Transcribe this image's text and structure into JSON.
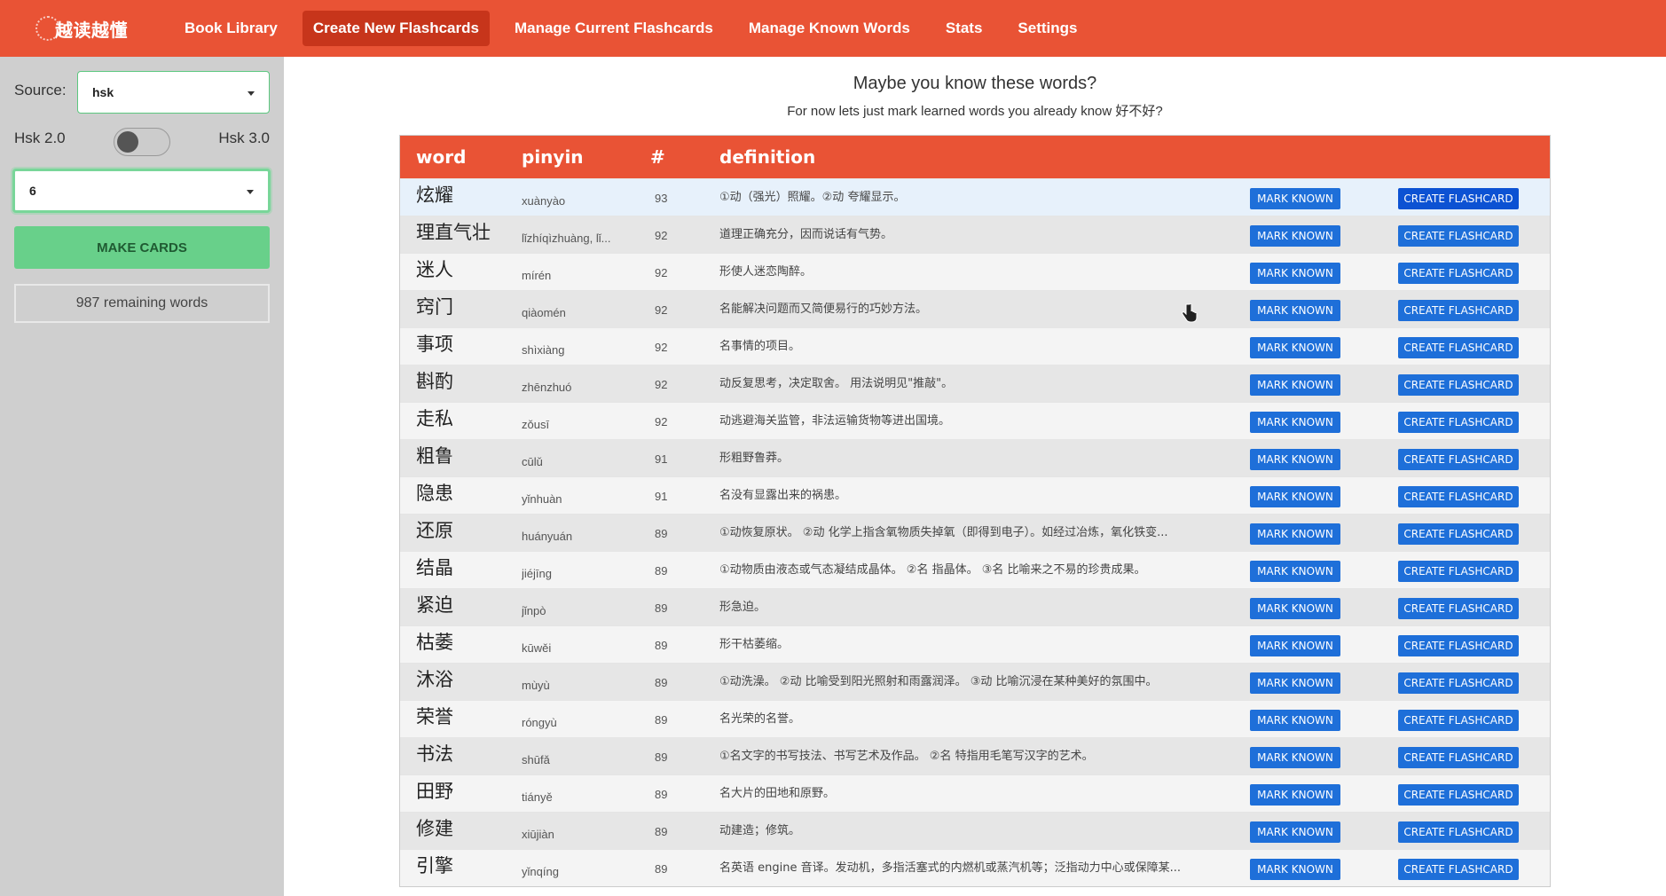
{
  "app": {
    "logo_text": "越读越懂",
    "nav": [
      {
        "label": "Book Library",
        "active": false
      },
      {
        "label": "Create New Flashcards",
        "active": true
      },
      {
        "label": "Manage Current Flashcards",
        "active": false
      },
      {
        "label": "Manage Known Words",
        "active": false
      },
      {
        "label": "Stats",
        "active": false
      },
      {
        "label": "Settings",
        "active": false
      }
    ]
  },
  "sidebar": {
    "source_label": "Source:",
    "source_value": "hsk",
    "hsk_left_label": "Hsk 2.0",
    "hsk_right_label": "Hsk 3.0",
    "level_value": "6",
    "make_cards_label": "MAKE CARDS",
    "remaining_text": "987 remaining words"
  },
  "main": {
    "heading": "Maybe you know these words?",
    "subheading": "For now lets just mark learned words you already know 好不好?",
    "table": {
      "headers": {
        "word": "word",
        "pinyin": "pinyin",
        "count": "#",
        "definition": "definition"
      },
      "mark_known_label": "MARK KNOWN",
      "create_flashcard_label": "CREATE FLASHCARD",
      "rows": [
        {
          "word": "炫耀",
          "pinyin": "xuànyào",
          "count": "93",
          "definition": "①动（强光）照耀。②动 夸耀显示。"
        },
        {
          "word": "理直气壮",
          "pinyin": "lǐzhíqìzhuàng, lǐ...",
          "count": "92",
          "definition": "道理正确充分，因而说话有气势。"
        },
        {
          "word": "迷人",
          "pinyin": "mírén",
          "count": "92",
          "definition": "形使人迷恋陶醉。"
        },
        {
          "word": "窍门",
          "pinyin": "qiàomén",
          "count": "92",
          "definition": "名能解决问题而又简便易行的巧妙方法。"
        },
        {
          "word": "事项",
          "pinyin": "shìxiàng",
          "count": "92",
          "definition": "名事情的项目。"
        },
        {
          "word": "斟酌",
          "pinyin": "zhēnzhuó",
          "count": "92",
          "definition": "动反复思考，决定取舍。 用法说明见\"推敲\"。"
        },
        {
          "word": "走私",
          "pinyin": "zǒusī",
          "count": "92",
          "definition": "动逃避海关监管，非法运输货物等进出国境。"
        },
        {
          "word": "粗鲁",
          "pinyin": "cūlǔ",
          "count": "91",
          "definition": "形粗野鲁莽。"
        },
        {
          "word": "隐患",
          "pinyin": "yǐnhuàn",
          "count": "91",
          "definition": "名没有显露出来的祸患。"
        },
        {
          "word": "还原",
          "pinyin": "huányuán",
          "count": "89",
          "definition": "①动恢复原状。 ②动 化学上指含氧物质失掉氧（即得到电子）。如经过冶炼，氧化铁变..."
        },
        {
          "word": "结晶",
          "pinyin": "jiéjīng",
          "count": "89",
          "definition": "①动物质由液态或气态凝结成晶体。 ②名 指晶体。 ③名 比喻来之不易的珍贵成果。"
        },
        {
          "word": "紧迫",
          "pinyin": "jǐnpò",
          "count": "89",
          "definition": "形急迫。"
        },
        {
          "word": "枯萎",
          "pinyin": "kūwěi",
          "count": "89",
          "definition": "形干枯萎缩。"
        },
        {
          "word": "沐浴",
          "pinyin": "mùyù",
          "count": "89",
          "definition": "①动洗澡。 ②动 比喻受到阳光照射和雨露润泽。 ③动 比喻沉浸在某种美好的氛围中。"
        },
        {
          "word": "荣誉",
          "pinyin": "róngyù",
          "count": "89",
          "definition": "名光荣的名誉。"
        },
        {
          "word": "书法",
          "pinyin": "shūfǎ",
          "count": "89",
          "definition": "①名文字的书写技法、书写艺术及作品。 ②名 特指用毛笔写汉字的艺术。"
        },
        {
          "word": "田野",
          "pinyin": "tiányě",
          "count": "89",
          "definition": "名大片的田地和原野。"
        },
        {
          "word": "修建",
          "pinyin": "xiūjiàn",
          "count": "89",
          "definition": "动建造；修筑。"
        },
        {
          "word": "引擎",
          "pinyin": "yǐnqíng",
          "count": "89",
          "definition": "名英语 engine 音译。发动机，多指活塞式的内燃机或蒸汽机等；泛指动力中心或保障某..."
        }
      ]
    }
  },
  "colors": {
    "brand": "#e95335",
    "nav_active": "#c7351b",
    "button_blue": "#1e6fd9",
    "make_cards_green": "#68d08a"
  }
}
